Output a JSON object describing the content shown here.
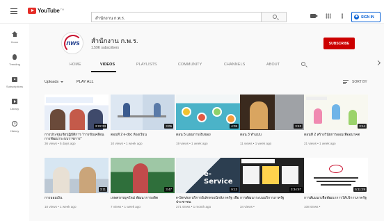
{
  "header": {
    "logo_text": "YouTube",
    "logo_region": "TH",
    "search_value": "สำนักงาน ก.พ.ร.",
    "signin_label": "SIGN IN",
    "icons": [
      "menu-icon",
      "search-icon",
      "video-camera-icon",
      "apps-grid-icon",
      "more-vert-icon",
      "account-icon"
    ]
  },
  "sidebar": {
    "items": [
      {
        "label": "Home",
        "icon": "home-icon"
      },
      {
        "label": "Trending",
        "icon": "flame-icon"
      },
      {
        "label": "Subscriptions",
        "icon": "subscriptions-icon"
      },
      {
        "label": "Library",
        "icon": "library-icon"
      },
      {
        "label": "History",
        "icon": "history-icon"
      }
    ]
  },
  "channel": {
    "name": "สำนักงาน ก.พ.ร.",
    "subscribers": "1.59K subscribers",
    "avatar_text": "nws",
    "subscribe_label": "SUBSCRIBE"
  },
  "tabs": [
    "HOME",
    "VIDEOS",
    "PLAYLISTS",
    "COMMUNITY",
    "CHANNELS",
    "ABOUT"
  ],
  "toolbar": {
    "uploads_label": "Uploads",
    "play_all_label": "PLAY ALL",
    "sort_label": "SORT BY"
  },
  "videos": [
    {
      "title": "การประชุมเชิงปฏิบัติการ \"การขับเคลื่อนการพัฒนาระบบราชการ\"",
      "meta": "36 views • 5 days ago",
      "duration": "2:22:33"
    },
    {
      "title": "ตอนที่ 2 e-doc ห้องเรียน",
      "meta": "10 views • 1 week ago",
      "duration": "3:06"
    },
    {
      "title": "ตอน 5 แผนการเงินของ",
      "meta": "19 views • 1 week ago",
      "duration": "4:09"
    },
    {
      "title": "ตอน 3 ทำแบบ",
      "meta": "11 views • 1 week ago",
      "duration": "3:43"
    },
    {
      "title": "ตอนที่ 2 สร้างวินัยการออมเพื่ออนาคต",
      "meta": "21 views • 1 week ago",
      "duration": "3:14"
    },
    {
      "title": "การออมเงิน",
      "meta": "10 views • 1 week ago",
      "duration": "3:11"
    },
    {
      "title": "เกษตรกรยุคใหม่ พัฒนาการผลิต",
      "meta": "7 views • 1 week ago",
      "duration": "3:47"
    },
    {
      "title": "e-Service บริการอิเล็กทรอนิกส์ภาครัฐ เพื่อประชาชน",
      "meta": "271 views • 1 month ago",
      "duration": "9:13",
      "overlay": "e-Service"
    },
    {
      "title": "การพัฒนาระบบบริการภาครัฐ",
      "meta": "34 views •",
      "duration": "3:34:57"
    },
    {
      "title": "การสัมมนาเพื่อพัฒนาการให้บริการภาครัฐ",
      "meta": "108 views •",
      "duration": "5:11:29"
    }
  ]
}
